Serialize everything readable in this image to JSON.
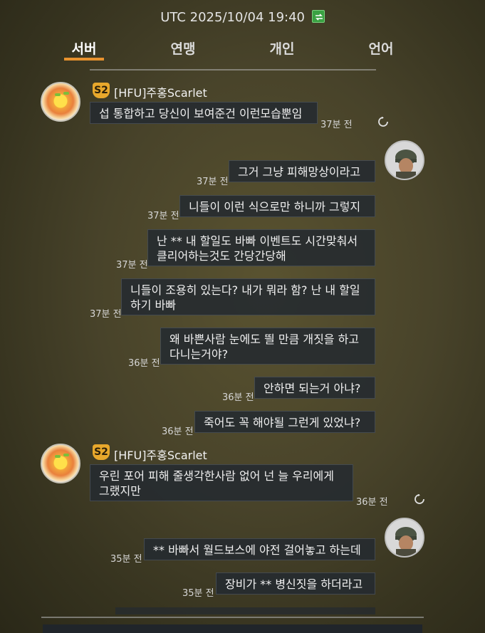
{
  "header": {
    "time": "UTC 2025/10/04 19:40",
    "tabs": [
      {
        "label": "서버"
      },
      {
        "label": "연맹"
      },
      {
        "label": "개인"
      },
      {
        "label": "언어"
      }
    ]
  },
  "colors": {
    "accent": "#e8922e",
    "badge": "#e8a82c",
    "bubble": "#242a30"
  },
  "messages": [
    {
      "sender_badge": "S2",
      "sender": "[HFU]주홍Scarlet",
      "text": "섭 통합하고 당신이 보여준건 이런모습뿐임",
      "time": "37분 전"
    },
    {
      "text": "그거 그냥 피해망상이라고",
      "time": "37분 전"
    },
    {
      "text": "니들이 이런 식으로만 하니까 그렇지",
      "time": "37분 전"
    },
    {
      "text": "난 **  내 할일도 바빠 이벤트도 시간맞춰서\n클리어하는것도 간당간당해",
      "time": "37분 전"
    },
    {
      "text": "니들이 조용히 있는다? 내가 뭐라 함? 난 내 할일\n하기 바빠",
      "time": "37분 전"
    },
    {
      "text": "왜 바쁜사람 눈에도 띌 만큼 개짓을 하고\n다니는거야?",
      "time": "36분 전"
    },
    {
      "text": "안하면 되는거 아냐?",
      "time": "36분 전"
    },
    {
      "text": "죽어도 꼭 해야될 그런게 있었냐?",
      "time": "36분 전"
    },
    {
      "sender_badge": "S2",
      "sender": "[HFU]주홍Scarlet",
      "text": "우린 포어 피해 줄생각한사람 없어  넌  늘 우리에게\n그랬지만",
      "time": "36분 전"
    },
    {
      "text": "** 바빠서 월드보스에 야전 걸어놓고 하는데",
      "time": "35분 전"
    },
    {
      "text": "장비가 ** 병신짓을 하더라고",
      "time": "35분 전"
    }
  ]
}
